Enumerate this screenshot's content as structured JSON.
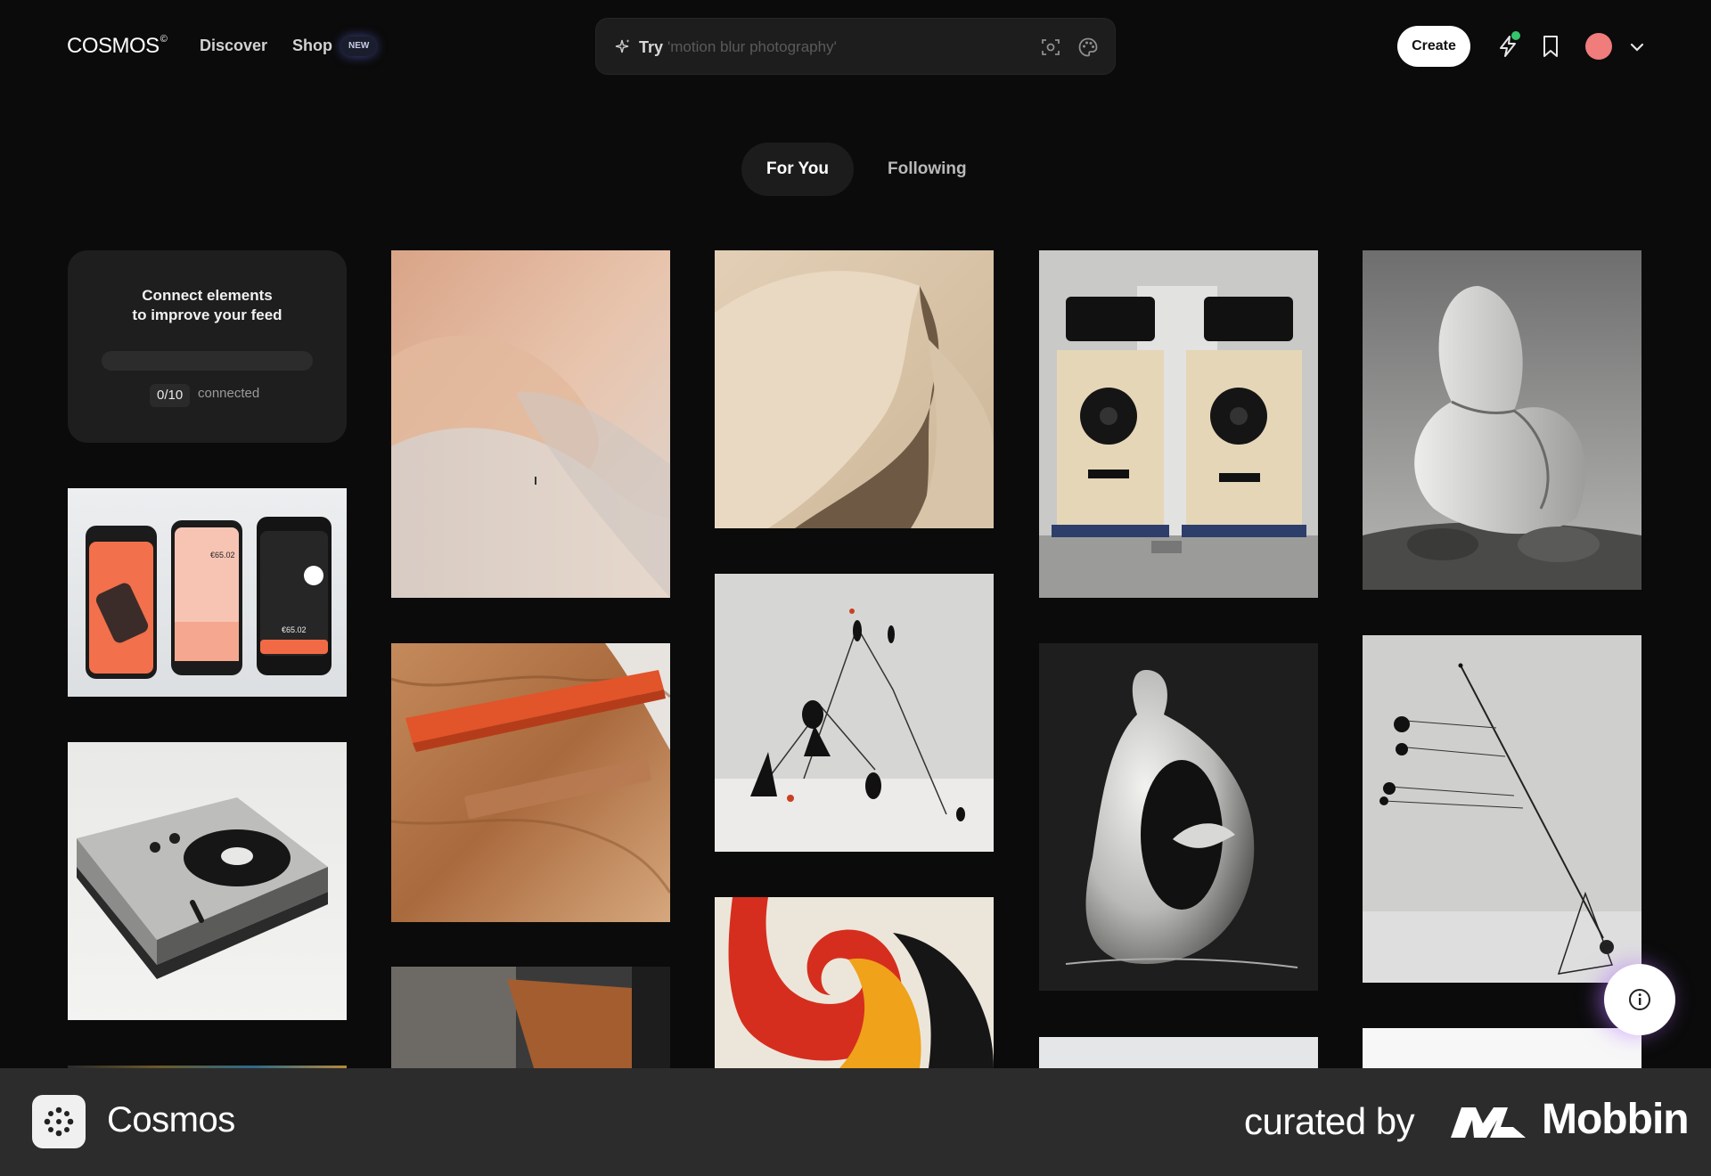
{
  "header": {
    "logo": "COSMOS",
    "logo_mark": "©",
    "nav": {
      "discover": "Discover",
      "shop": "Shop",
      "shop_badge": "NEW"
    },
    "search": {
      "prefix": "Try",
      "placeholder": "'motion blur photography'"
    },
    "create_label": "Create",
    "icons": [
      "sparkle-icon",
      "lens-search-icon",
      "palette-icon",
      "bolt-icon",
      "bookmark-icon",
      "chevron-down-icon"
    ],
    "avatar_color": "#f07c7c"
  },
  "tabs": {
    "for_you": "For You",
    "following": "Following",
    "active": "For You"
  },
  "connect_card": {
    "title": "Connect elements\nto improve your feed",
    "count": "0/10",
    "count_label": "connected",
    "progress_fraction": 0
  },
  "feed": {
    "tiles": [
      "peach-sand-dunes",
      "desert-dune-shadow",
      "speakers-on-carts",
      "bw-ribbon-sculpture",
      "finance-app-screens",
      "orange-comb-in-hair",
      "calder-mobile-sculpture",
      "bw-ceramic-vessel",
      "bw-wire-mobile",
      "turntable-product",
      "wood-metal-interior",
      "red-orange-black-swirl-art",
      "partial-gray-image",
      "partial-white-image",
      "partial-colorful-image"
    ]
  },
  "footer": {
    "app_name": "Cosmos",
    "curated_by": "curated by",
    "brand": "Mobbin"
  },
  "colors": {
    "background": "#0b0b0b",
    "card": "#1e1e1e",
    "footer": "#2c2c2c",
    "notification_dot": "#36c46a",
    "fab_glow": "#b46eff"
  }
}
